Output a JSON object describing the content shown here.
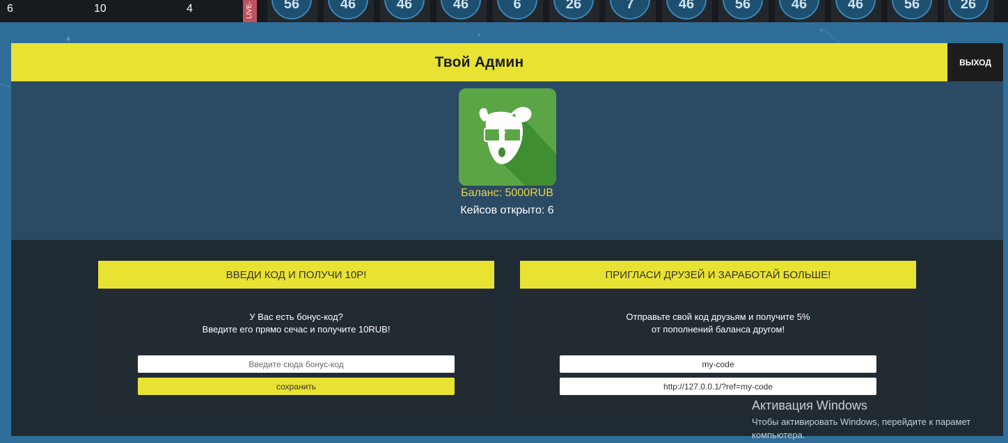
{
  "top_bar": {
    "stats": [
      "6",
      "10",
      "4"
    ],
    "live_label": "LIVE-",
    "live_items": [
      "56",
      "46",
      "46",
      "46",
      "6",
      "26",
      "7",
      "46",
      "56",
      "46",
      "46",
      "56",
      "26"
    ]
  },
  "header": {
    "title": "Твой Админ",
    "exit_label": "ВЫХОД"
  },
  "profile": {
    "balance": "Баланс: 5000RUB",
    "cases_opened": "Кейсов открыто: 6",
    "avatar_icon": "vk-dog-sunglasses-icon"
  },
  "bonus_card": {
    "title": "ВВЕДИ КОД И ПОЛУЧИ 10Р!",
    "text_line1": "У Вас есть бонус-код?",
    "text_line2": "Введите его прямо сечас и получите 10RUB!",
    "input_placeholder": "Введите сюда бонус-код",
    "save_label": "сохранить"
  },
  "referral_card": {
    "title": "ПРИГЛАСИ ДРУЗЕЙ И ЗАРАБОТАЙ БОЛЬШЕ!",
    "text_line1": "Отправьте свой код друзьям и получите 5%",
    "text_line2": "от пополнений баланса другом!",
    "code_value": "my-code",
    "link_value": "http://127.0.0.1/?ref=my-code"
  },
  "windows_watermark": {
    "title": "Активация Windows",
    "line1": "Чтобы активировать Windows, перейдите к парамет",
    "line2": "компьютера."
  },
  "colors": {
    "accent_yellow": "#e8e233",
    "balance_gold": "#e8d64a",
    "panel_blue": "#2b4a63",
    "dark_section": "#1f2a33",
    "background": "#2f6e99"
  }
}
